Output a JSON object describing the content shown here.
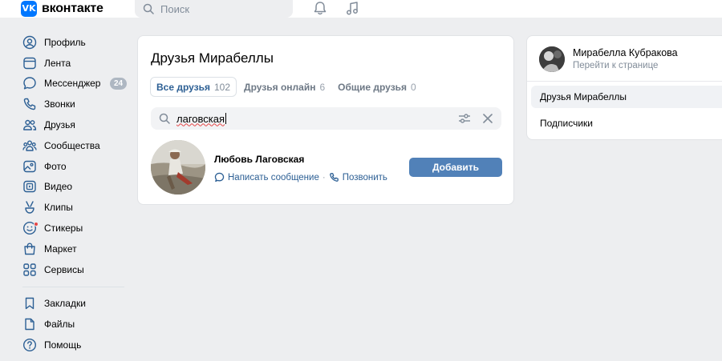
{
  "header": {
    "logo_glyph": "VK",
    "logo_text": "вконтакте",
    "search_placeholder": "Поиск",
    "icons": [
      "bell-icon",
      "music-note-icon"
    ]
  },
  "nav": {
    "items": [
      {
        "label": "Профиль",
        "icon": "profile-icon"
      },
      {
        "label": "Лента",
        "icon": "feed-icon"
      },
      {
        "label": "Мессенджер",
        "icon": "messenger-icon",
        "badge": "24"
      },
      {
        "label": "Звонки",
        "icon": "phone-icon"
      },
      {
        "label": "Друзья",
        "icon": "friends-icon"
      },
      {
        "label": "Сообщества",
        "icon": "communities-icon"
      },
      {
        "label": "Фото",
        "icon": "photo-icon"
      },
      {
        "label": "Видео",
        "icon": "video-icon"
      },
      {
        "label": "Клипы",
        "icon": "clips-icon"
      },
      {
        "label": "Стикеры",
        "icon": "stickers-icon"
      },
      {
        "label": "Маркет",
        "icon": "market-icon"
      },
      {
        "label": "Сервисы",
        "icon": "services-icon"
      }
    ],
    "secondary": [
      {
        "label": "Закладки",
        "icon": "bookmark-icon"
      },
      {
        "label": "Файлы",
        "icon": "file-icon"
      },
      {
        "label": "Помощь",
        "icon": "help-icon"
      }
    ]
  },
  "main": {
    "title": "Друзья Мирабеллы",
    "tabs": [
      {
        "label": "Все друзья",
        "count": "102"
      },
      {
        "label": "Друзья онлайн",
        "count": "6"
      },
      {
        "label": "Общие друзья",
        "count": "0"
      }
    ],
    "search_value": "лаговская",
    "friend": {
      "name": "Любовь Лаговская",
      "message_link": "Написать сообщение",
      "separator": "·",
      "call_link": "Позвонить",
      "add_button": "Добавить"
    }
  },
  "right": {
    "name": "Мирабелла Кубракова",
    "subtitle": "Перейти к странице",
    "selected": "Друзья Мирабеллы",
    "item": "Подписчики"
  },
  "colors": {
    "accent": "#0077ff",
    "button": "#5181b8",
    "link": "#2c5f94",
    "background": "#edeef0"
  }
}
